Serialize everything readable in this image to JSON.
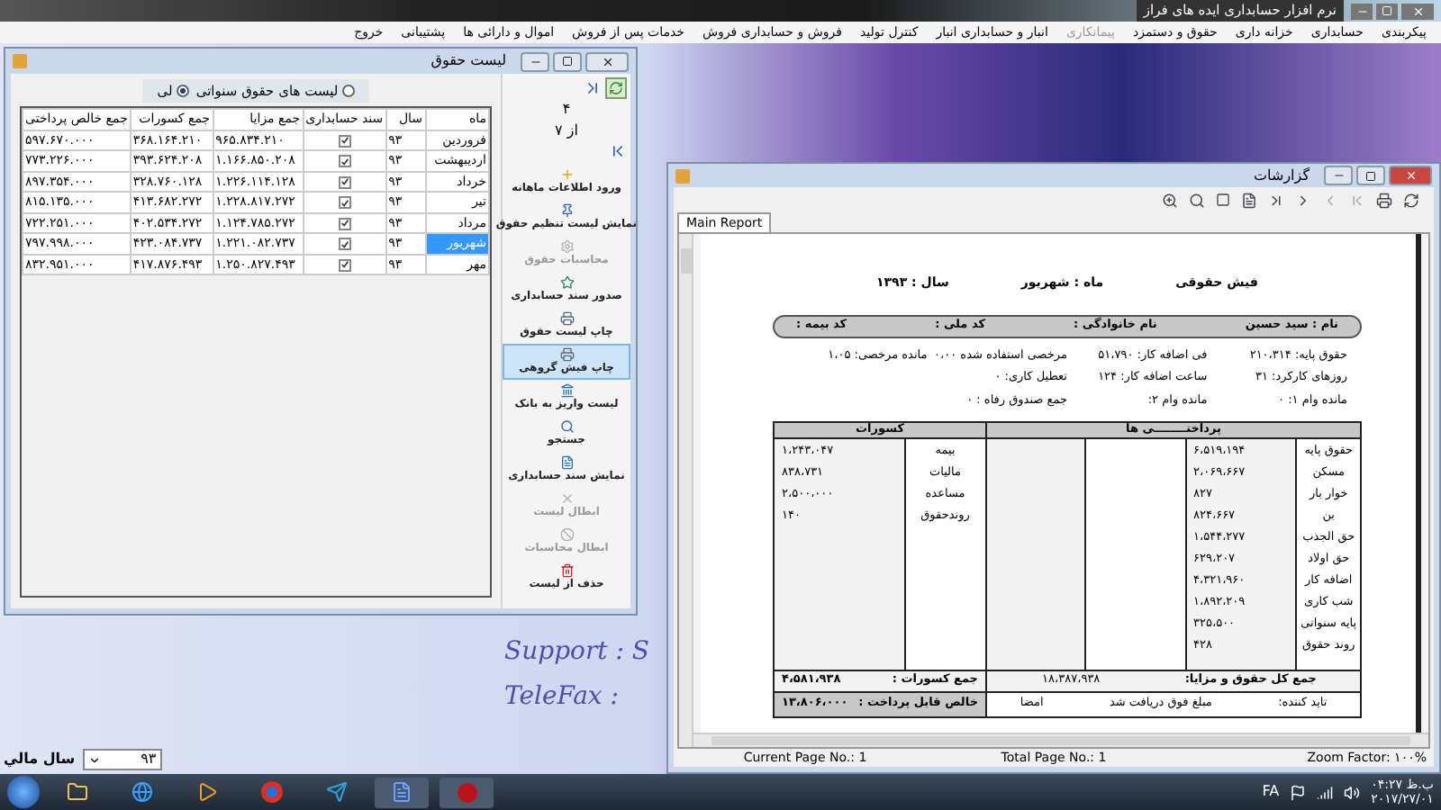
{
  "app_title": "نرم افزار حسابداری ایده های فراز",
  "menu": [
    {
      "label": "پیکربندی",
      "disabled": false
    },
    {
      "label": "حسابداری",
      "disabled": false
    },
    {
      "label": "خزانه داری",
      "disabled": false
    },
    {
      "label": "حقوق و دستمزد",
      "disabled": false
    },
    {
      "label": "پیمانکاری",
      "disabled": true
    },
    {
      "label": "انبار و حسابداری انبار",
      "disabled": false
    },
    {
      "label": "کنترل تولید",
      "disabled": false
    },
    {
      "label": "فروش و حسابداری فروش",
      "disabled": false
    },
    {
      "label": "خدمات پس از فروش",
      "disabled": false
    },
    {
      "label": "اموال و دارائی ها",
      "disabled": false
    },
    {
      "label": "پشتیبانی",
      "disabled": false
    },
    {
      "label": "خروج",
      "disabled": false
    }
  ],
  "desktop_texts": [
    "Support : S",
    "TeleFax : "
  ],
  "payroll_window": {
    "title": "لیست حقوق",
    "view_options": [
      {
        "label": "لیست های حقوق سنواتی",
        "selected": false
      },
      {
        "label": "لی",
        "selected": true
      }
    ],
    "columns": [
      "ماه",
      "سال",
      "سند حسابداری",
      "جمع مزایا",
      "جمع کسورات",
      "جمع خالص پرداختی"
    ],
    "rows": [
      {
        "month": "فروردین",
        "year": "۹۳",
        "posted": true,
        "benefits": "۹۶۵.۸۳۴.۲۱۰",
        "deductions": "۳۶۸.۱۶۴.۲۱۰",
        "net": "۵۹۷.۶۷۰.۰۰۰",
        "selected": false
      },
      {
        "month": "اردیبهشت",
        "year": "۹۳",
        "posted": true,
        "benefits": "۱.۱۶۶.۸۵۰.۲۰۸",
        "deductions": "۳۹۳.۶۲۴.۲۰۸",
        "net": "۷۷۳.۲۲۶.۰۰۰",
        "selected": false
      },
      {
        "month": "خرداد",
        "year": "۹۳",
        "posted": true,
        "benefits": "۱.۲۲۶.۱۱۴.۱۲۸",
        "deductions": "۳۲۸.۷۶۰.۱۲۸",
        "net": "۸۹۷.۳۵۴.۰۰۰",
        "selected": false
      },
      {
        "month": "تیر",
        "year": "۹۳",
        "posted": true,
        "benefits": "۱.۲۲۸.۸۱۷.۲۷۲",
        "deductions": "۴۱۳.۶۸۲.۲۷۲",
        "net": "۸۱۵.۱۳۵.۰۰۰",
        "selected": false
      },
      {
        "month": "مرداد",
        "year": "۹۳",
        "posted": true,
        "benefits": "۱.۱۲۴.۷۸۵.۲۷۲",
        "deductions": "۴۰۲.۵۳۴.۲۷۲",
        "net": "۷۲۲.۲۵۱.۰۰۰",
        "selected": false
      },
      {
        "month": "شهریور",
        "year": "۹۳",
        "posted": true,
        "benefits": "۱.۲۲۱.۰۸۲.۷۳۷",
        "deductions": "۴۲۳.۰۸۴.۷۳۷",
        "net": "۷۹۷.۹۹۸.۰۰۰",
        "selected": true
      },
      {
        "month": "مهر",
        "year": "۹۳",
        "posted": true,
        "benefits": "۱.۲۵۰.۸۲۷.۴۹۳",
        "deductions": "۴۱۷.۸۷۶.۴۹۳",
        "net": "۸۳۲.۹۵۱.۰۰۰",
        "selected": false
      }
    ],
    "pager": {
      "current": "۴",
      "total": "از ۷"
    },
    "actions": [
      {
        "kind": "add",
        "label": "ورود اطلاعات ماهانه",
        "disabled": false,
        "selected": false
      },
      {
        "kind": "pin",
        "label": "نمایش لیست تنظیم حقوق",
        "disabled": false,
        "selected": false
      },
      {
        "kind": "gear",
        "label": "محاسبات حقوق",
        "disabled": true,
        "selected": false
      },
      {
        "kind": "star",
        "label": "صدور سند حسابداری",
        "disabled": false,
        "selected": false
      },
      {
        "kind": "print",
        "label": "چاپ لیست حقوق",
        "disabled": false,
        "selected": false
      },
      {
        "kind": "print",
        "label": "چاپ فیش گروهی",
        "disabled": false,
        "selected": true
      },
      {
        "kind": "bank",
        "label": "لیست واریز به بانک",
        "disabled": false,
        "selected": false
      },
      {
        "kind": "search",
        "label": "جستجو",
        "disabled": false,
        "selected": false
      },
      {
        "kind": "doc",
        "label": "نمایش سند حسابداری",
        "disabled": false,
        "selected": false
      },
      {
        "kind": "cancel",
        "label": "ابطال لیست",
        "disabled": true,
        "selected": false
      },
      {
        "kind": "stop",
        "label": "ابطال محاسبات",
        "disabled": true,
        "selected": false
      },
      {
        "kind": "delete",
        "label": "حذف از لیست",
        "disabled": false,
        "selected": false
      }
    ]
  },
  "fiscal_year": {
    "label": "سال مالي",
    "value": "۹۳"
  },
  "report_window": {
    "title": "گزارشات",
    "tab": "Main Report",
    "slip": {
      "heading": "فیش حقوقی",
      "month": "ماه : شهریور",
      "year": "سال : ۱۳۹۳",
      "identity": [
        "نام : سید حسین",
        "نام خانوادگی :",
        "کد ملی :",
        "کد بیمه :"
      ],
      "info": [
        [
          "حقوق پایه: ۲۱۰،۳۱۴",
          "فی اضافه کار: ۵۱،۷۹۰",
          "مرخصی استفاده شده ۰،۰۰",
          "مانده مرخصی: ۱،۰۵"
        ],
        [
          "روزهای کارکرد: ۳۱",
          "ساعت اضافه کار: ۱۲۴",
          "تعطیل کاری: ۰"
        ],
        [
          "مانده وام ۱: ۰",
          "مانده وام ۲:",
          "جمع صندوق رفاه : ۰"
        ]
      ],
      "payments_header": "پرداختــــــــی ها",
      "deductions_header": "کسورات",
      "payments": [
        {
          "label": "حقوق پایه",
          "amount": "۶،۵۱۹،۱۹۴"
        },
        {
          "label": "مسکن",
          "amount": "۲،۰۶۹،۶۶۷"
        },
        {
          "label": "خوار بار",
          "amount": "۸۲۷"
        },
        {
          "label": "بن",
          "amount": "۸۲۴،۶۶۷"
        },
        {
          "label": "حق الجذب",
          "amount": "۱،۵۴۴،۲۷۷"
        },
        {
          "label": "حق اولاد",
          "amount": "۶۲۹،۲۰۷"
        },
        {
          "label": "اضافه کار",
          "amount": "۴،۳۲۱،۹۶۰"
        },
        {
          "label": "شب کاری",
          "amount": "۱،۸۹۲،۲۰۹"
        },
        {
          "label": "پایه سنواتی",
          "amount": "۳۲۵،۵۰۰"
        },
        {
          "label": "روند حقوق",
          "amount": "۴۲۸"
        }
      ],
      "deductions": [
        {
          "label": "بیمه",
          "amount": "۱،۲۴۳،۰۴۷"
        },
        {
          "label": "مالیات",
          "amount": "۸۳۸،۷۳۱"
        },
        {
          "label": "مساعده",
          "amount": "۲،۵۰۰،۰۰۰"
        },
        {
          "label": "روندحقوق",
          "amount": "۱۴۰"
        }
      ],
      "total_payments_label": "جمع کل حقوق و مزایا:",
      "total_payments": "۱۸،۳۸۷،۹۳۸",
      "total_deductions_label": "جمع کسورات :",
      "total_deductions": "۴،۵۸۱،۹۳۸",
      "net_label": "خالص قابل پرداخت :",
      "net": "۱۳،۸۰۶،۰۰۰",
      "footer": [
        "تاید کننده:",
        "مبلغ فوق دریافت شد",
        "امضا"
      ]
    },
    "status": [
      "Zoom Factor: ۱۰۰%",
      "Total Page No.: 1",
      "Current Page No.: 1"
    ]
  },
  "taskbar": {
    "language": "FA",
    "time": "۰۴:۲۷ ب.ظ",
    "date": "۲۰۱۷/۲۷/۰۱"
  }
}
